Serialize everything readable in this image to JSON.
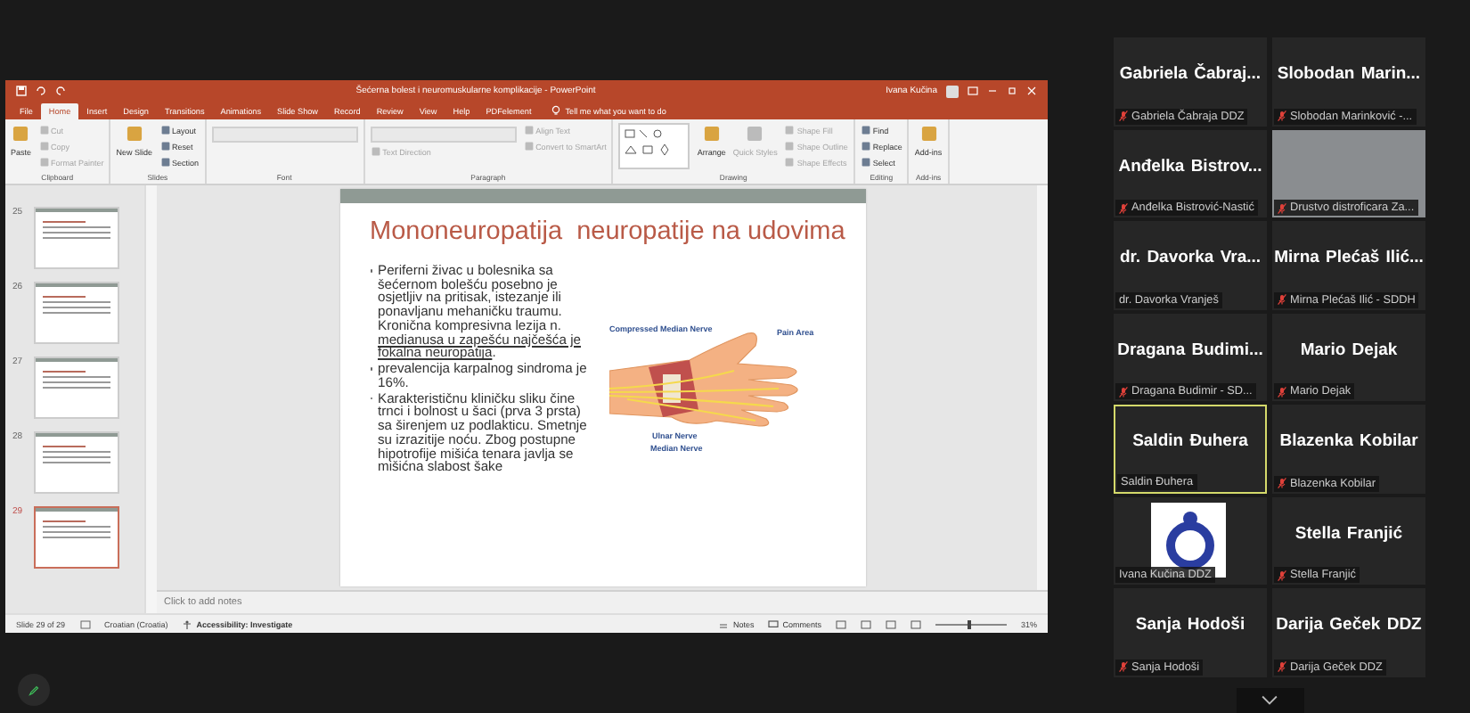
{
  "ppt": {
    "title": "Šećerna bolest i neuromuskularne komplikacije - PowerPoint",
    "user": "Ivana Kučina",
    "tabs": [
      {
        "label": "File",
        "selected": false
      },
      {
        "label": "Home",
        "selected": true
      },
      {
        "label": "Insert",
        "selected": false
      },
      {
        "label": "Design",
        "selected": false
      },
      {
        "label": "Transitions",
        "selected": false
      },
      {
        "label": "Animations",
        "selected": false
      },
      {
        "label": "Slide Show",
        "selected": false
      },
      {
        "label": "Record",
        "selected": false
      },
      {
        "label": "Review",
        "selected": false
      },
      {
        "label": "View",
        "selected": false
      },
      {
        "label": "Help",
        "selected": false
      },
      {
        "label": "PDFelement",
        "selected": false
      }
    ],
    "tell_me": "Tell me what you want to do",
    "ribbon_groups": [
      {
        "label": "Clipboard",
        "items": [
          {
            "kind": "large",
            "label": "Paste",
            "disabled": false
          },
          {
            "kind": "small",
            "label": "Cut",
            "disabled": true
          },
          {
            "kind": "small",
            "label": "Copy",
            "disabled": true
          },
          {
            "kind": "small",
            "label": "Format Painter",
            "disabled": true
          }
        ]
      },
      {
        "label": "Slides",
        "items": [
          {
            "kind": "large",
            "label": "New Slide",
            "disabled": false
          },
          {
            "kind": "small",
            "label": "Layout",
            "disabled": false
          },
          {
            "kind": "small",
            "label": "Reset",
            "disabled": false
          },
          {
            "kind": "small",
            "label": "Section",
            "disabled": false
          }
        ]
      },
      {
        "label": "Font",
        "items": [
          {
            "kind": "field",
            "disabled": true
          }
        ]
      },
      {
        "label": "Paragraph",
        "items": [
          {
            "kind": "field",
            "disabled": true
          },
          {
            "kind": "small",
            "label": "Text Direction",
            "disabled": true
          },
          {
            "kind": "small",
            "label": "Align Text",
            "disabled": true
          },
          {
            "kind": "small",
            "label": "Convert to SmartArt",
            "disabled": true
          }
        ]
      },
      {
        "label": "Drawing",
        "items": [
          {
            "kind": "gallery"
          },
          {
            "kind": "large",
            "label": "Arrange",
            "disabled": false
          },
          {
            "kind": "large",
            "label": "Quick Styles",
            "disabled": true
          },
          {
            "kind": "small",
            "label": "Shape Fill",
            "disabled": true
          },
          {
            "kind": "small",
            "label": "Shape Outline",
            "disabled": true
          },
          {
            "kind": "small",
            "label": "Shape Effects",
            "disabled": true
          }
        ]
      },
      {
        "label": "Editing",
        "items": [
          {
            "kind": "small",
            "label": "Find",
            "disabled": false
          },
          {
            "kind": "small",
            "label": "Replace",
            "disabled": false
          },
          {
            "kind": "small",
            "label": "Select",
            "disabled": false
          }
        ]
      },
      {
        "label": "Add-ins",
        "items": [
          {
            "kind": "large",
            "label": "Add-ins",
            "disabled": false
          }
        ]
      }
    ],
    "slides": [
      {
        "number": "25",
        "selected": false
      },
      {
        "number": "26",
        "selected": false
      },
      {
        "number": "27",
        "selected": false
      },
      {
        "number": "28",
        "selected": false
      },
      {
        "number": "29",
        "selected": true
      }
    ],
    "slide": {
      "title": "Mononeuropatija  neuropatije na udovima",
      "bullets": [
        {
          "segments": [
            {
              "text": "Periferni živac u bolesnika sa šećernom bolešću posebno je osjetljiv na pritisak, istezanje ili ponavljanu mehaničku traumu. Kronična kompresivna lezija n. ",
              "underline": false
            },
            {
              "text": "medianusa u zapešću najčešća je fokalna neuropatija",
              "underline": true
            },
            {
              "text": ".",
              "underline": false
            }
          ]
        },
        {
          "segments": [
            {
              "text": "prevalencija karpalnog sindroma je 16%.",
              "underline": false
            }
          ]
        },
        {
          "segments": [
            {
              "text": "Karakterističnu kliničku sliku čine trnci i bolnost u šaci (prva 3 prsta) sa širenjem uz podlakticu. Smetnje su izrazitije noću. Zbog postupne hipotrofije mišića tenara javlja se mišićna slabost šake",
              "underline": false
            }
          ]
        }
      ],
      "figure_labels": [
        "Compressed Median Nerve",
        "Pain Area",
        "Ulnar Nerve",
        "Median Nerve"
      ]
    },
    "notes_placeholder": "Click to add notes",
    "status_bar": {
      "slide_count": "Slide 29 of 29",
      "language": "Croatian (Croatia)",
      "accessibility": "Accessibility: Investigate",
      "notes": "Notes",
      "comments": "Comments",
      "zoom": "31%",
      "zoom_slider": {
        "level": 0.45
      }
    }
  },
  "participants": [
    {
      "kind": "name",
      "display_name": "Gabriela Čabraj...",
      "label": "Gabriela Čabraja DDZ",
      "muted": true,
      "active": false
    },
    {
      "kind": "name",
      "display_name": "Slobodan Marin...",
      "label": "Slobodan Marinković -...",
      "muted": true,
      "active": false
    },
    {
      "kind": "name",
      "display_name": "Anđelka Bistrov...",
      "label": "Anđelka Bistrović-Nastić",
      "muted": true,
      "active": false
    },
    {
      "kind": "video",
      "label": "Drustvo distroficara Za...",
      "muted": true,
      "active": false
    },
    {
      "kind": "name",
      "display_name": "dr. Davorka Vra...",
      "label": "dr. Davorka Vranješ",
      "muted": false,
      "active": false
    },
    {
      "kind": "name",
      "display_name": "Mirna Plećaš Ilić...",
      "label": "Mirna Plećaš Ilić - SDDH",
      "muted": true,
      "active": false
    },
    {
      "kind": "name",
      "display_name": "Dragana Budimi...",
      "label": "Dragana Budimir - SD...",
      "muted": true,
      "active": false
    },
    {
      "kind": "name",
      "display_name": "Mario Dejak",
      "label": "Mario Dejak",
      "muted": true,
      "active": false
    },
    {
      "kind": "name",
      "display_name": "Saldin Đuhera",
      "label": "Saldin Đuhera",
      "muted": false,
      "active": true
    },
    {
      "kind": "name",
      "display_name": "Blazenka Kobilar",
      "label": "Blazenka Kobilar",
      "muted": true,
      "active": false
    },
    {
      "kind": "logo",
      "label": "Ivana Kučina DDZ",
      "muted": false,
      "active": false
    },
    {
      "kind": "name",
      "display_name": "Stella Franjić",
      "label": "Stella Franjić",
      "muted": true,
      "active": false
    },
    {
      "kind": "name",
      "display_name": "Sanja Hodoši",
      "label": "Sanja Hodoši",
      "muted": true,
      "active": false
    },
    {
      "kind": "name",
      "display_name": "Darija Geček DDZ",
      "label": "Darija Geček DDZ",
      "muted": true,
      "active": false
    }
  ]
}
